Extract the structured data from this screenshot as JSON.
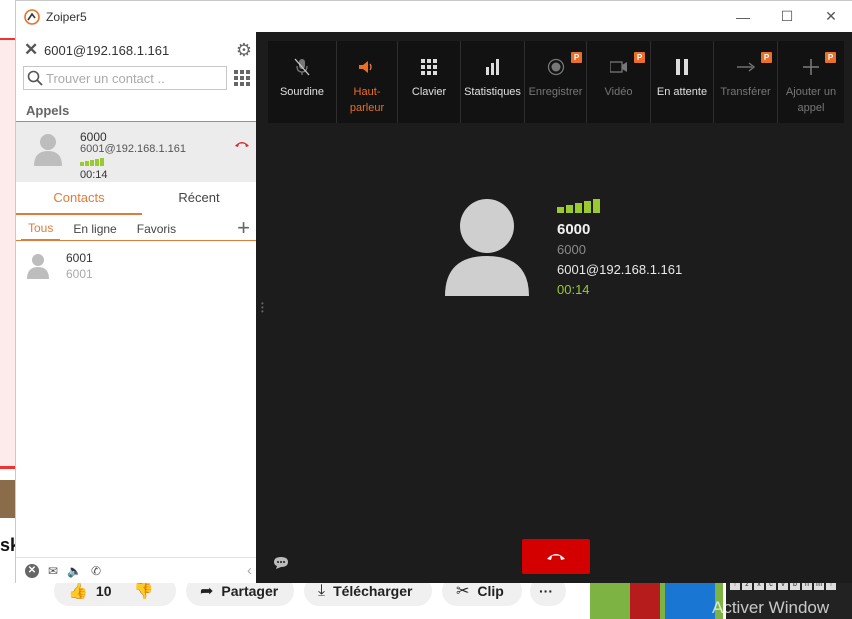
{
  "background": {
    "left_heading_fragment": "sk",
    "like_count": "10",
    "share_label": "Partager",
    "download_label": "Télécharger",
    "clip_label": "Clip",
    "more_label": "···",
    "activate_watermark": "Activer Window"
  },
  "window": {
    "title": "Zoiper5",
    "minimize": "—",
    "maximize": "☐",
    "close": "✕"
  },
  "left": {
    "account": "6001@192.168.1.161",
    "search_placeholder": "Trouver un contact ..",
    "calls_header": "Appels",
    "active_call": {
      "name": "6000",
      "address": "6001@192.168.1.161",
      "duration": "00:14"
    },
    "tabs": [
      "Contacts",
      "Récent"
    ],
    "filters": [
      "Tous",
      "En ligne",
      "Favoris"
    ],
    "contacts": [
      {
        "name": "6001",
        "number": "6001"
      }
    ]
  },
  "toolbar": {
    "items": [
      {
        "label": "Sourdine",
        "icon": "mic-off-icon"
      },
      {
        "label": "Haut-parleur",
        "icon": "speaker-icon"
      },
      {
        "label": "Clavier",
        "icon": "keypad-icon"
      },
      {
        "label": "Statistiques",
        "icon": "stats-icon"
      },
      {
        "label": "Enregistrer",
        "icon": "record-icon",
        "badge": "P"
      },
      {
        "label": "Vidéo",
        "icon": "video-icon",
        "badge": "P"
      },
      {
        "label": "En attente",
        "icon": "pause-icon"
      },
      {
        "label": "Transférer",
        "icon": "transfer-icon",
        "badge": "P"
      },
      {
        "label": "Ajouter un appel",
        "icon": "add-call-icon",
        "badge": "P"
      }
    ]
  },
  "call": {
    "name": "6000",
    "number": "6000",
    "address": "6001@192.168.1.161",
    "duration": "00:14"
  },
  "colors": {
    "accent": "#e8702a",
    "signal": "#9ac930",
    "hangup": "#d40000",
    "dark_bg": "#1c1c1c"
  }
}
